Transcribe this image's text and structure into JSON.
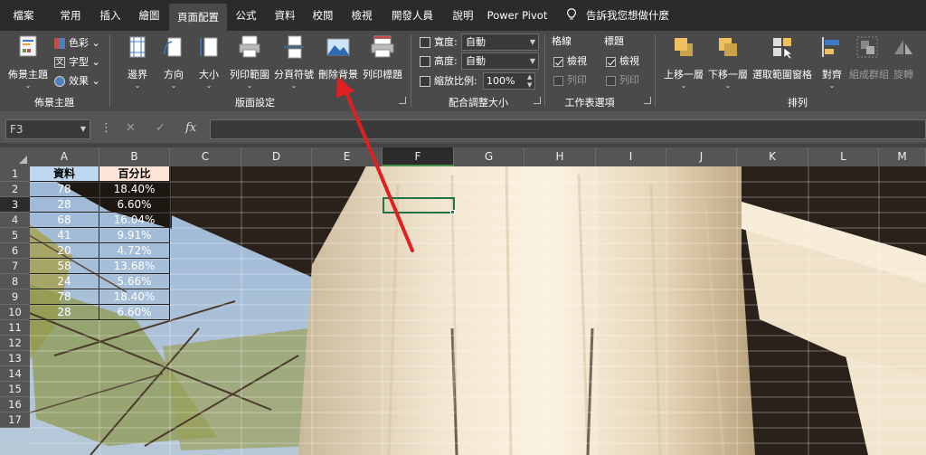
{
  "tabs": [
    {
      "label": "檔案"
    },
    {
      "label": "常用"
    },
    {
      "label": "插入"
    },
    {
      "label": "繪圖"
    },
    {
      "label": "頁面配置"
    },
    {
      "label": "公式"
    },
    {
      "label": "資料"
    },
    {
      "label": "校閱"
    },
    {
      "label": "檢視"
    },
    {
      "label": "開發人員"
    },
    {
      "label": "說明"
    },
    {
      "label": "Power Pivot"
    }
  ],
  "tell_me": "告訴我您想做什麼",
  "ribbon": {
    "themes": {
      "themes_button": "佈景主題",
      "colors": "色彩",
      "fonts": "字型",
      "effects": "效果",
      "label": "佈景主題"
    },
    "page_setup": {
      "margins": "邊界",
      "orientation": "方向",
      "size": "大小",
      "print_area": "列印範圍",
      "breaks": "分頁符號",
      "delete_background": "刪除背景",
      "print_titles": "列印標題",
      "label": "版面設定"
    },
    "scale_to_fit": {
      "width_label": "寬度:",
      "width_value": "自動",
      "height_label": "高度:",
      "height_value": "自動",
      "scale_label": "縮放比例:",
      "scale_value": "100%",
      "label": "配合調整大小"
    },
    "sheet_options": {
      "gridlines": "格線",
      "headings": "標題",
      "view": "檢視",
      "print": "列印",
      "label": "工作表選項"
    },
    "arrange": {
      "bring_forward": "上移一層",
      "send_backward": "下移一層",
      "selection_pane": "選取範圍窗格",
      "align": "對齊",
      "group": "組成群組",
      "rotate": "旋轉",
      "label": "排列"
    }
  },
  "formula_bar": {
    "name_box": "F3",
    "fx": "fx"
  },
  "columns": [
    "A",
    "B",
    "C",
    "D",
    "E",
    "F",
    "G",
    "H",
    "I",
    "J",
    "K",
    "L",
    "M"
  ],
  "rows": [
    "1",
    "2",
    "3",
    "4",
    "5",
    "6",
    "7",
    "8",
    "9",
    "10",
    "11",
    "12",
    "13",
    "14",
    "15",
    "16",
    "17"
  ],
  "table": {
    "header_data": "資料",
    "header_pct": "百分比",
    "data": [
      "78",
      "28",
      "68",
      "41",
      "20",
      "58",
      "24",
      "78",
      "28"
    ],
    "pct": [
      "18.40%",
      "6.60%",
      "16.04%",
      "9.91%",
      "4.72%",
      "13.68%",
      "5.66%",
      "18.40%",
      "6.60%"
    ]
  },
  "colors": {
    "accent_green": "#217346",
    "arrow_red": "#e02020",
    "header_fill": "#bdd7ee",
    "pct_header_fill": "#fce4d6"
  }
}
